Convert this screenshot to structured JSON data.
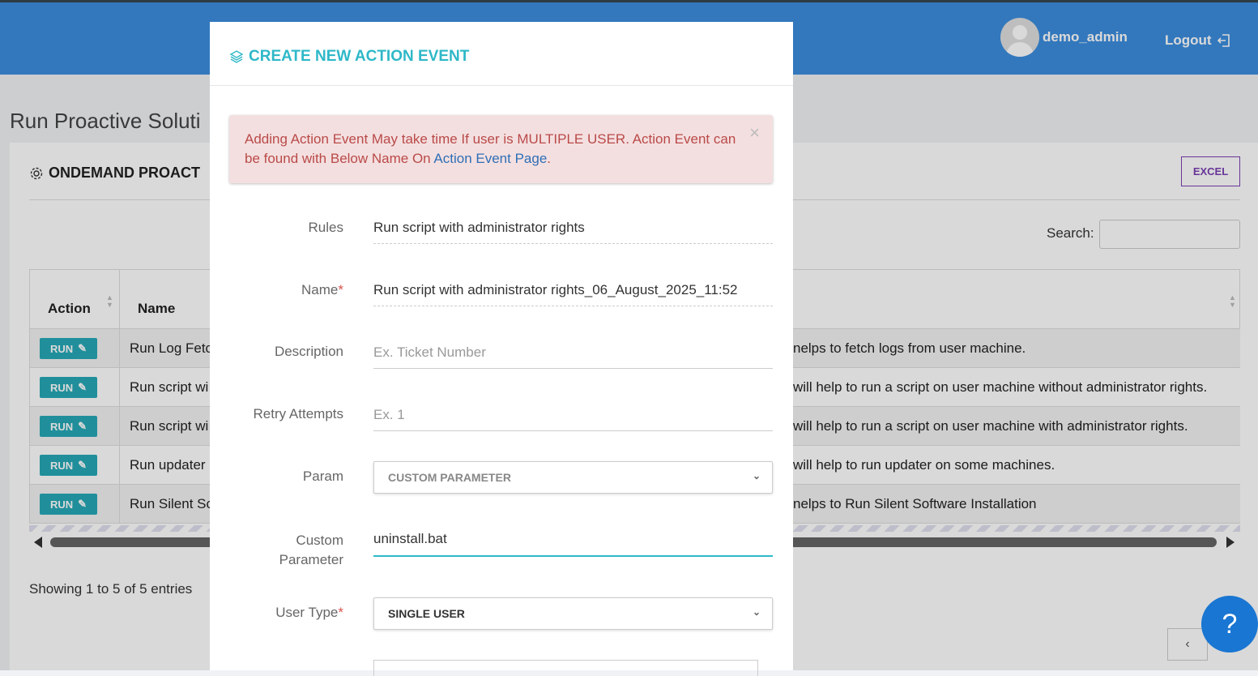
{
  "header": {
    "username": "demo_admin",
    "logout_label": "Logout"
  },
  "page": {
    "title": "Run Proactive Soluti",
    "card_title": "ONDEMAND PROACT",
    "excel_label": "EXCEL",
    "search_label": "Search:",
    "showing": "Showing 1 to 5 of 5 entries",
    "pager_prev": "‹",
    "help": "?"
  },
  "table": {
    "columns": [
      "Action",
      "Name"
    ],
    "run_label": "RUN",
    "rows": [
      {
        "name": "Run Log Fetc",
        "desc": "nelps to fetch logs from user machine."
      },
      {
        "name": "Run script wi",
        "desc": "will help to run a script on user machine without administrator rights."
      },
      {
        "name": "Run script wi",
        "desc": "will help to run a script on user machine with administrator rights."
      },
      {
        "name": "Run updater",
        "desc": "will help to run updater on some machines."
      },
      {
        "name": "Run Silent Sc",
        "desc": "nelps to Run Silent Software Installation"
      }
    ]
  },
  "modal": {
    "title": "CREATE NEW ACTION EVENT",
    "alert_text": "Adding Action Event May take time If user is MULTIPLE USER. Action Event can be found with Below Name On ",
    "alert_link": "Action Event Page",
    "alert_end": ".",
    "alert_close": "×",
    "fields": {
      "rules_label": "Rules",
      "rules_value": "Run script with administrator rights",
      "name_label": "Name",
      "name_value": "Run script with administrator rights_06_August_2025_11:52",
      "required_mark": "*",
      "desc_label": "Description",
      "desc_placeholder": "Ex. Ticket Number",
      "retry_label": "Retry Attempts",
      "retry_placeholder": "Ex. 1",
      "param_label": "Param",
      "param_value": "CUSTOM PARAMETER",
      "custom_label_1": "Custom",
      "custom_label_2": "Parameter",
      "custom_value": "uninstall.bat",
      "usertype_label": "User Type",
      "usertype_value": "SINGLE USER"
    }
  },
  "colors": {
    "topbar": "#3c8dde",
    "accent": "#2eb8c8",
    "run": "#26a9b7",
    "alert_bg": "#f4dfe0",
    "alert_text": "#b94a48"
  }
}
